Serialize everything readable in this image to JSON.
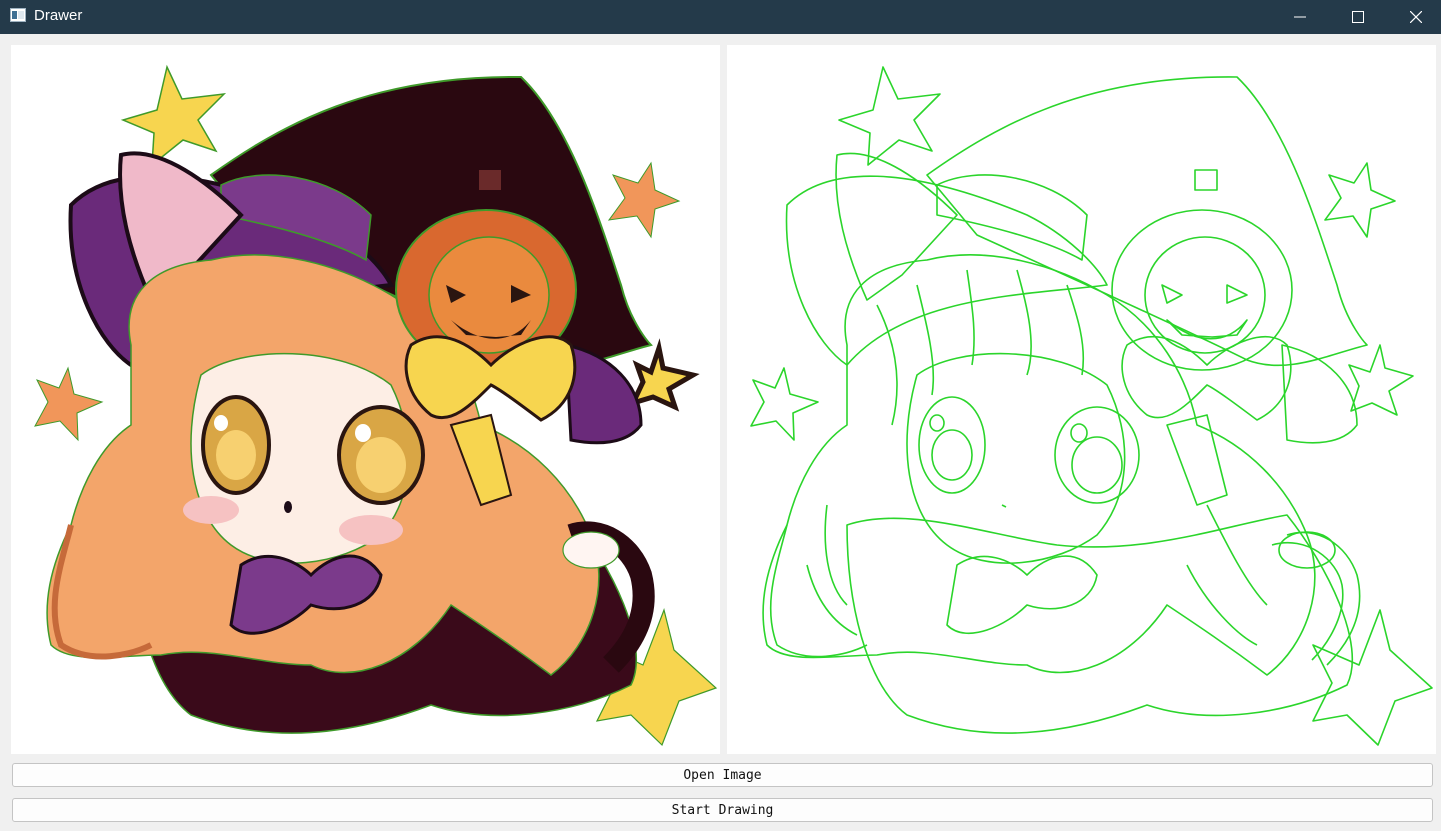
{
  "window": {
    "title": "Drawer",
    "title_icon": "app-window-icon",
    "controls": [
      "minimize-icon",
      "maximize-icon",
      "close-icon"
    ]
  },
  "panels": {
    "source": {
      "description_icon": "source-image"
    },
    "output": {
      "line_color": "#33cc33"
    }
  },
  "buttons": {
    "open_image": "Open Image",
    "start_drawing": "Start Drawing"
  },
  "colors": {
    "titlebar": "#243a4a",
    "background": "#f0f0f0",
    "outline": "#2bd52b"
  }
}
